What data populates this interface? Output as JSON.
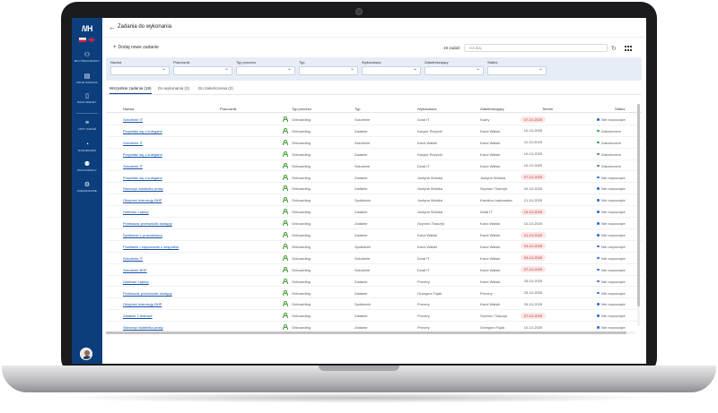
{
  "app": {
    "logo_text": "/\\/H",
    "page_title": "Zadania do wykonania"
  },
  "sidebar": {
    "items": [
      {
        "label": "Moi pracownicy",
        "icon": "person-icon"
      },
      {
        "label": "Moje zadania",
        "icon": "clipboard-icon"
      },
      {
        "label": "Baza wiedzy",
        "icon": "book-icon"
      },
      {
        "label": "Listy zadań",
        "icon": "list-icon"
      },
      {
        "label": "Dashboard",
        "icon": "dashboard-icon"
      },
      {
        "label": "Pracownicy",
        "icon": "people-icon"
      },
      {
        "label": "Zarządzanie",
        "icon": "gear-icon"
      }
    ]
  },
  "toolbar": {
    "add_label": "Dodaj nowe zadanie",
    "results": "19 zadań",
    "search_placeholder": "Szukaj"
  },
  "filters": [
    {
      "label": "Nazwa"
    },
    {
      "label": "Pracownik"
    },
    {
      "label": "Typ procesu"
    },
    {
      "label": "Typ"
    },
    {
      "label": "Wykonawca"
    },
    {
      "label": "Zatwierdzający"
    },
    {
      "label": "Status"
    }
  ],
  "tabs": [
    {
      "label": "Wszystkie zadania (19)"
    },
    {
      "label": "Do wykonania (2)"
    },
    {
      "label": "Do zakończenia (2)"
    }
  ],
  "table": {
    "columns": [
      "Nazwa",
      "Pracownik",
      "Typ procesu",
      "Typ",
      "Wykonawca",
      "Zatwierdzający",
      "Termin",
      "Status"
    ],
    "rows": [
      {
        "name": "Szkolenie IT",
        "process": "Onboarding",
        "type": "Szkolenie",
        "executor": "Dział IT",
        "approver": "Kadry",
        "due": "07-10-2025",
        "overdue": true,
        "status": "Nie rozpoczęte",
        "state": "open"
      },
      {
        "name": "Przywitać się z kolegami",
        "process": "Onboarding",
        "type": "Zadanie",
        "executor": "Kacper Rożycki",
        "approver": "Karol Walski",
        "due": "10-10-2025",
        "overdue": false,
        "status": "Zakończone",
        "state": "done"
      },
      {
        "name": "Szkolenie IT",
        "process": "Onboarding",
        "type": "Szkolenie",
        "executor": "Karol Walski",
        "approver": "Karol Walski",
        "due": "11-10-2025",
        "overdue": false,
        "status": "Zakończone",
        "state": "done"
      },
      {
        "name": "Przywitać się z kolegami",
        "process": "Onboarding",
        "type": "Zadanie",
        "executor": "Kacper Rożycki",
        "approver": "Karol Walski",
        "due": "10-10-2025",
        "overdue": false,
        "status": "Zakończone",
        "state": "done"
      },
      {
        "name": "Szkolenie IT",
        "process": "Onboarding",
        "type": "Szkolenie",
        "executor": "Dział IT",
        "approver": "Karol Walski",
        "due": "10-10-2025",
        "overdue": false,
        "status": "Zakończone",
        "state": "done"
      },
      {
        "name": "Przywitać się z kolegami",
        "process": "Onboarding",
        "type": "Zadanie",
        "executor": "Justyna Wolska",
        "approver": "Justyna Wolska",
        "due": "07-10-2025",
        "overdue": true,
        "status": "Nie rozpoczęte",
        "state": "open"
      },
      {
        "name": "Stworzyć światełko prasy",
        "process": "Onboarding",
        "type": "Zadanie",
        "executor": "Justyna Wolska",
        "approver": "Szymon Tkaczyk",
        "due": "20-10-2025",
        "overdue": false,
        "status": "Nie rozpoczęte",
        "state": "open"
      },
      {
        "name": "Obejrzeć instrukcję BHP",
        "process": "Onboarding",
        "type": "Spotkanie",
        "executor": "Justyna Wolska",
        "approver": "Karolina Laskowska",
        "due": "21-10-2025",
        "overdue": false,
        "status": "Nie rozpoczęte",
        "state": "open"
      },
      {
        "name": "Odebrać Laptop",
        "process": "Onboarding",
        "type": "Zadanie",
        "executor": "Justyna Wolska",
        "approver": "Dział IT",
        "due": "15-10-2025",
        "overdue": true,
        "status": "Nie rozpoczęte",
        "state": "open"
      },
      {
        "name": "Przekazać przeszkolić dostępy",
        "process": "Onboarding",
        "type": "Zadanie",
        "executor": "Szymon Tkaczyk",
        "approver": "Karol Walski",
        "due": "10-10-2025",
        "overdue": false,
        "status": "Nie rozpoczęte",
        "state": "open"
      },
      {
        "name": "Spotkanie z pracodawcą",
        "process": "Onboarding",
        "type": "Zadanie",
        "executor": "Karol Walski",
        "approver": "Karol Walski",
        "due": "01-10-2025",
        "overdue": true,
        "status": "Nie rozpoczęte",
        "state": "open"
      },
      {
        "name": "Powitanie i zapoznanie z zespołem",
        "process": "Onboarding",
        "type": "Spotkanie",
        "executor": "Karol Walski",
        "approver": "Karol Walski",
        "due": "03-10-2025",
        "overdue": true,
        "status": "Nie rozpoczęte",
        "state": "open"
      },
      {
        "name": "Szkolenie IT",
        "process": "Onboarding",
        "type": "Szkolenie",
        "executor": "Dział IT",
        "approver": "Karol Walski",
        "due": "03-10-2025",
        "overdue": true,
        "status": "Nie rozpoczęte",
        "state": "open"
      },
      {
        "name": "Szkolenie BHP",
        "process": "Onboarding",
        "type": "Szkolenie",
        "executor": "Dział IT",
        "approver": "Karol Walski",
        "due": "07-10-2025",
        "overdue": true,
        "status": "Nie rozpoczęte",
        "state": "open"
      },
      {
        "name": "Odebrać Laptop",
        "process": "Onboarding",
        "type": "Zadanie",
        "executor": "Provery",
        "approver": "Karol Walski",
        "due": "25-10-2025",
        "overdue": false,
        "status": "Nie rozpoczęte",
        "state": "open"
      },
      {
        "name": "Przekazać przeszkolić dostępy",
        "process": "Onboarding",
        "type": "Zadanie",
        "executor": "Grzegorz Fujak",
        "approver": "Provery",
        "due": "25-10-2025",
        "overdue": false,
        "status": "Nie rozpoczęte",
        "state": "open"
      },
      {
        "name": "Obejrzeć instrukcję BHP",
        "process": "Onboarding",
        "type": "Spotkanie",
        "executor": "Provery",
        "approver": "Karol Walski",
        "due": "25-10-2025",
        "overdue": false,
        "status": "Nie rozpoczęte",
        "state": "open"
      },
      {
        "name": "Zadanie 1 testowe",
        "process": "Onboarding",
        "type": "Zadanie",
        "executor": "Provery",
        "approver": "Szymon Tkaczyk",
        "due": "07-10-2025",
        "overdue": true,
        "status": "Nie rozpoczęte",
        "state": "open"
      },
      {
        "name": "Stworzyć światełko prasy",
        "process": "Onboarding",
        "type": "Zadanie",
        "executor": "Provery",
        "approver": "Grzegorz Fujak",
        "due": "10-10-2025",
        "overdue": false,
        "status": "Nie rozpoczęte",
        "state": "open"
      }
    ]
  },
  "colors": {
    "sidebar": "#0c3e7c",
    "link": "#1452a6",
    "overdue_bg": "#fde6e6",
    "status_open": "#2f6fd6",
    "status_done": "#2e9e45"
  }
}
